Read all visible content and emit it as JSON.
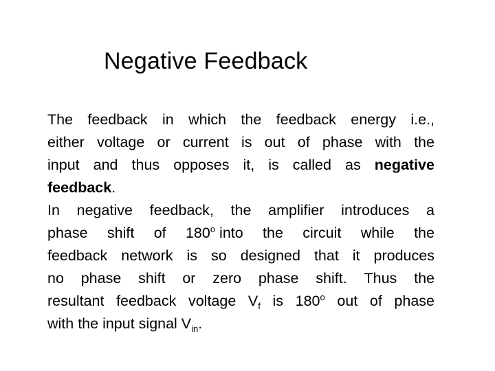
{
  "slide": {
    "title": "Negative Feedback",
    "paragraph1": {
      "lines": [
        [
          "The",
          "feedback",
          "in",
          "which",
          "the",
          "feedback",
          "energy",
          "i.e.,"
        ],
        [
          "either",
          "voltage",
          "or",
          "current",
          "is",
          "out",
          "of",
          "phase",
          "with",
          "the"
        ],
        [
          "input",
          "and",
          "thus",
          "opposes",
          "it,",
          "is",
          "called",
          "as"
        ],
        [],
        []
      ],
      "bold_term_part1": "negative",
      "bold_term_part2": "feedback",
      "end_punct": "."
    },
    "paragraph2": {
      "line1": [
        "In",
        "negative",
        "feedback,",
        "the",
        "amplifier",
        "introduces",
        "a"
      ],
      "line2_words": [
        "phase",
        "shift",
        "of"
      ],
      "line2_degree_value": "180",
      "line2_degree_symbol": "o",
      "line2_rest": [
        "into",
        "the",
        "circuit",
        "while",
        "the"
      ],
      "line3": [
        "feedback",
        "network",
        "is",
        "so",
        "designed",
        "that",
        "it",
        "produces"
      ],
      "line4": [
        "no",
        "phase",
        "shift",
        "or",
        "zero",
        "phase",
        "shift.",
        "Thus",
        "the"
      ],
      "line5_pre": "resultant feedback voltage V",
      "line5_sub": "f",
      "line5_mid": " is 180",
      "line5_sup": "o",
      "line5_post": " out of phase",
      "line6_pre": "with the input signal V",
      "line6_sub": "in",
      "line6_post": "."
    }
  }
}
